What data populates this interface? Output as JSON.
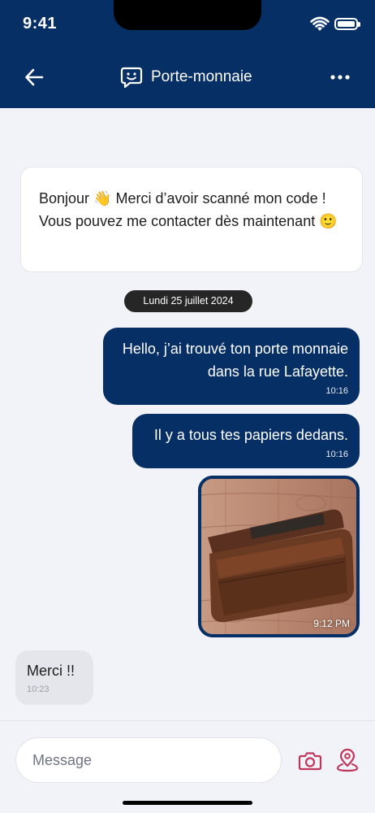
{
  "status_bar": {
    "time": "9:41"
  },
  "header": {
    "title": "Porte-monnaie"
  },
  "intro_card": {
    "text": "Bonjour 👋 Merci d’avoir scanné mon code ! Vous pouvez me contacter dès maintenant 🙂"
  },
  "date_separator": "Lundi 25 juillet 2024",
  "messages": [
    {
      "direction": "outgoing",
      "text": "Hello, j’ai trouvé ton porte monnaie dans la rue Lafayette.",
      "time": "10:16"
    },
    {
      "direction": "outgoing",
      "text": "Il y a tous tes papiers dedans.",
      "time": "10:16"
    },
    {
      "direction": "outgoing",
      "type": "image",
      "image_subject": "wallet photo",
      "time": "9:12 PM"
    },
    {
      "direction": "incoming",
      "text": "Merci !!",
      "time": "10:23"
    }
  ],
  "composer": {
    "placeholder": "Message"
  },
  "icons": {
    "back": "arrow-left-icon",
    "title": "chat-smile-icon",
    "more": "more-horizontal-icon",
    "camera": "camera-icon",
    "location": "location-pin-icon"
  },
  "colors": {
    "primary": "#062f66",
    "accent": "#c0365a",
    "background": "#f2f3f8",
    "incoming_bubble": "#e4e6eb"
  }
}
